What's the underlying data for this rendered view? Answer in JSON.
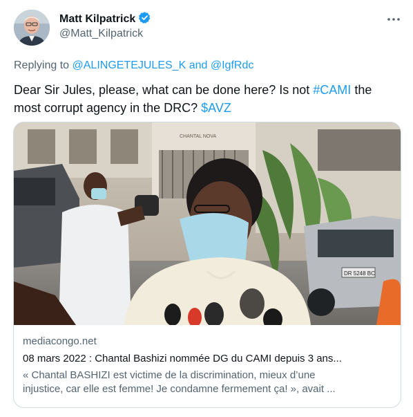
{
  "author": {
    "name": "Matt Kilpatrick",
    "handle": "@Matt_Kilpatrick",
    "verified": true,
    "verified_color": "#1d9bf0"
  },
  "reply": {
    "prefix": "Replying to",
    "user1": "@ALINGETEJULES_K",
    "conj": "and",
    "user2": "@IgfRdc"
  },
  "tweet": {
    "part1": "Dear Sir Jules, please, what can be done here? Is not",
    "hashtag": "#CAMI",
    "part2": "the most corrupt agency in the DRC?",
    "cashtag": "$AVZ"
  },
  "card": {
    "domain": "mediacongo.net",
    "title": "08 mars 2022 : Chantal Bashizi nommée DG du CAMI depuis 3 ans...",
    "description_line1": "« Chantal BASHIZI est victime de la discrimination, mieux d’une",
    "description_line2": "injustice, car elle est femme! Je condamne fermement ça! », avait ...",
    "image_sign": "CHANTAL NOVA",
    "plate": "DR 5248 BC"
  },
  "colors": {
    "link": "#1d9bf0",
    "text": "#0f1419",
    "secondary": "#536471",
    "border": "#cfd9de"
  }
}
